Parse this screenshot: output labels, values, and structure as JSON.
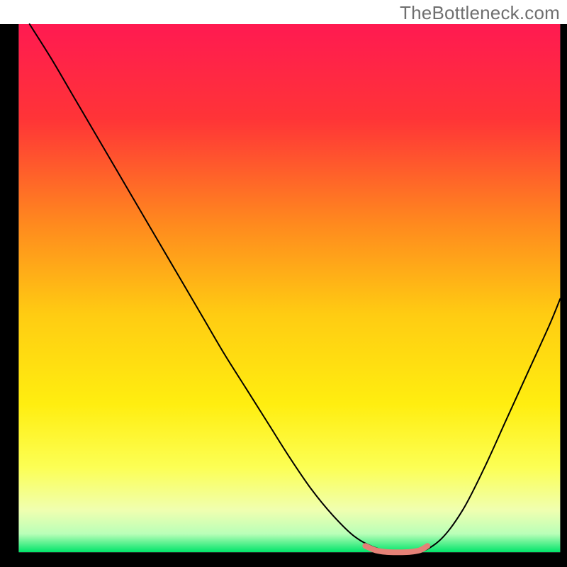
{
  "watermark": "TheBottleneck.com",
  "chart_data": {
    "type": "line",
    "title": "",
    "xlabel": "",
    "ylabel": "",
    "xlim": [
      0,
      100
    ],
    "ylim": [
      0,
      100
    ],
    "grid": false,
    "background_gradient": {
      "stops": [
        {
          "offset": 0.0,
          "color": "#ff1a51"
        },
        {
          "offset": 0.18,
          "color": "#ff3437"
        },
        {
          "offset": 0.38,
          "color": "#ff8a1e"
        },
        {
          "offset": 0.55,
          "color": "#ffcc12"
        },
        {
          "offset": 0.72,
          "color": "#ffee10"
        },
        {
          "offset": 0.84,
          "color": "#fcff55"
        },
        {
          "offset": 0.92,
          "color": "#f0ffb0"
        },
        {
          "offset": 0.965,
          "color": "#baffb8"
        },
        {
          "offset": 1.0,
          "color": "#00e46a"
        }
      ]
    },
    "series": [
      {
        "name": "bottleneck-curve",
        "color": "#000000",
        "x": [
          2,
          6,
          10,
          14,
          18,
          22,
          26,
          30,
          34,
          38,
          42,
          46,
          50,
          54,
          58,
          62,
          66,
          70,
          74,
          78,
          82,
          86,
          90,
          94,
          98,
          100
        ],
        "y": [
          100,
          93.5,
          86.5,
          79.5,
          72.5,
          65.5,
          58.5,
          51.5,
          44.5,
          37.5,
          31,
          24.5,
          18,
          12,
          7,
          3,
          0.8,
          0,
          0,
          2.5,
          8,
          16,
          25,
          34,
          43,
          48
        ]
      },
      {
        "name": "optimal-range",
        "color": "#e58177",
        "stroke_width": 8,
        "x": [
          64,
          66,
          68,
          70,
          72,
          74,
          75.5
        ],
        "y": [
          1.2,
          0.35,
          0.05,
          0,
          0.05,
          0.35,
          1.2
        ]
      }
    ],
    "frame": {
      "left_visible": true,
      "right_visible": true,
      "bottom_visible": true,
      "top_visible": false,
      "left_width_frac": 0.033,
      "right_width_frac": 0.012,
      "bottom_height_frac": 0.026
    }
  }
}
